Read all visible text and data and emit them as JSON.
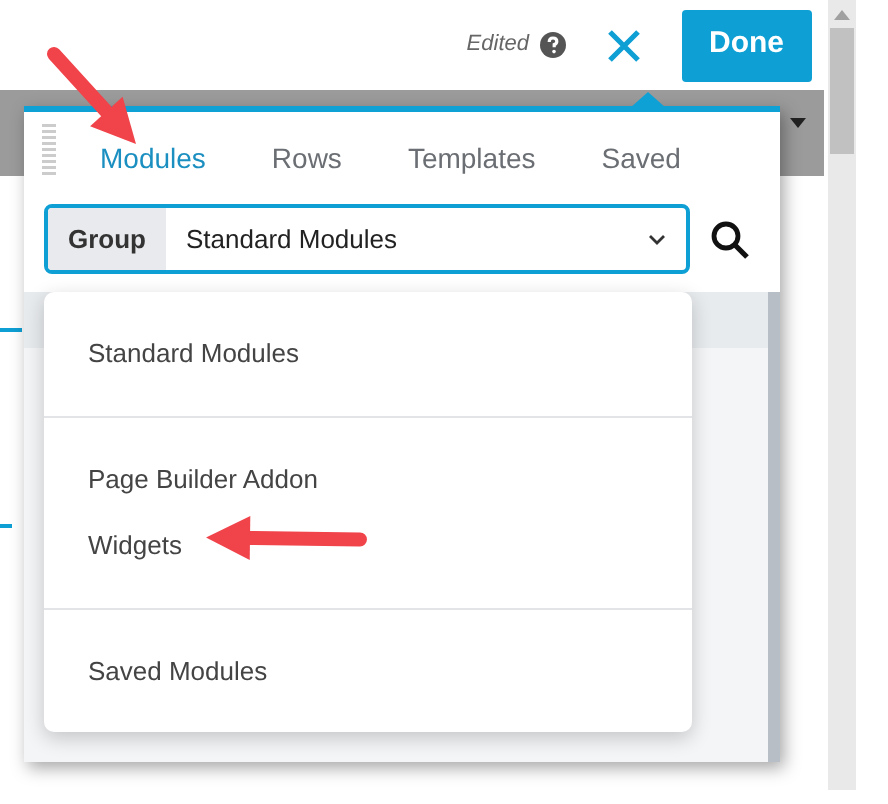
{
  "toolbar": {
    "status": "Edited",
    "done_button": "Done"
  },
  "tabs": [
    {
      "label": "Modules",
      "selected": true
    },
    {
      "label": "Rows",
      "selected": false
    },
    {
      "label": "Templates",
      "selected": false
    },
    {
      "label": "Saved",
      "selected": false
    }
  ],
  "group_select": {
    "label": "Group",
    "value": "Standard Modules"
  },
  "dropdown": {
    "groups": [
      {
        "options": [
          "Standard Modules"
        ]
      },
      {
        "options": [
          "Page Builder Addon",
          "Widgets"
        ]
      },
      {
        "options": [
          "Saved Modules"
        ]
      }
    ]
  }
}
